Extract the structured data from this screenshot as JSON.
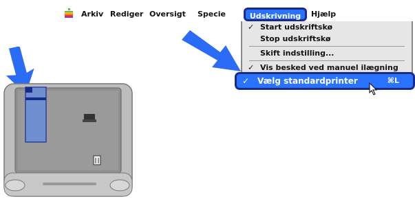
{
  "menubar": {
    "items": [
      "Arkiv",
      "Rediger",
      "Oversigt",
      "Specie"
    ],
    "active": "Udskrivning",
    "after": "Hjælp"
  },
  "dropdown": {
    "items": [
      {
        "check": "✓",
        "label": "Start udskriftskø"
      },
      {
        "check": "",
        "label": "Stop udskriftskø"
      },
      {
        "check": "",
        "label": "Skift indstilling..."
      },
      {
        "check": "✓",
        "label": "Vis besked ved manuel ilægning"
      }
    ],
    "selected": {
      "check": "✓",
      "label": "Vælg standardprinter",
      "shortcut": "⌘L"
    }
  },
  "colors": {
    "highlight": "#2a73ff",
    "outline": "#1a2a8a",
    "arrow": "#2a6cf5",
    "monitor": "#bdbdbd",
    "screen": "#9a9a9a",
    "window": "#6f8fd0"
  },
  "icons": [
    "apple-icon",
    "arrow-down-icon",
    "arrow-diagonal-icon",
    "printer-icon",
    "trash-icon",
    "cursor-icon"
  ]
}
